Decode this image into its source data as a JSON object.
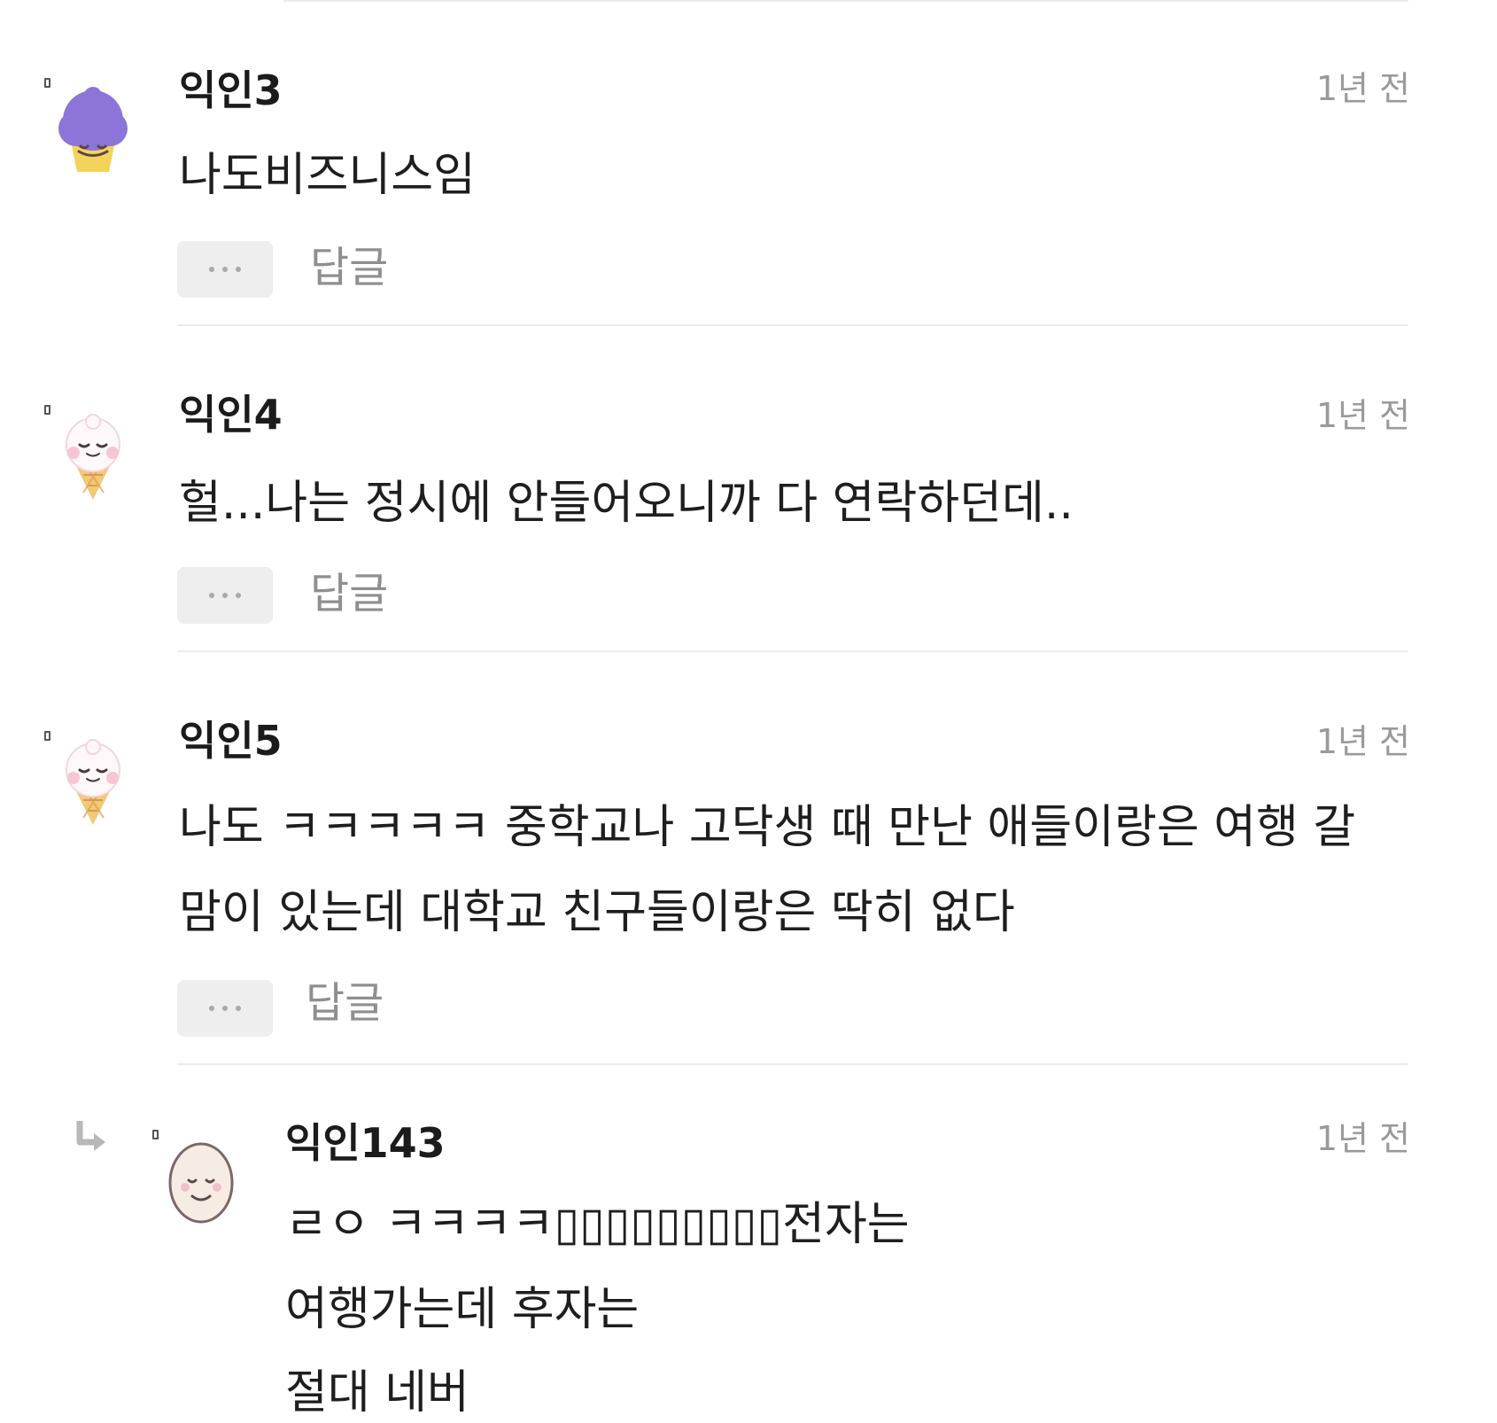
{
  "comments": [
    {
      "author": "익인3",
      "time": "1년 전",
      "lines": [
        "나도비즈니스임"
      ],
      "reply_label": "답글",
      "avatar_icon": "purple-ice-cream-icon"
    },
    {
      "author": "익인4",
      "time": "1년 전",
      "lines": [
        "헐...나는 정시에 안들어오니까 다 연락하던데.."
      ],
      "reply_label": "답글",
      "avatar_icon": "vanilla-ice-cream-cone-icon"
    },
    {
      "author": "익인5",
      "time": "1년 전",
      "lines": [
        "나도 ㅋㅋㅋㅋㅋ 중학교나 고닥생 때 만난 애들이랑은 여행 갈",
        "맘이 있는데 대학교 친구들이랑은 딱히 없다"
      ],
      "reply_label": "답글",
      "avatar_icon": "vanilla-ice-cream-cone-icon"
    }
  ],
  "reply": {
    "author": "익인143",
    "time": "1년 전",
    "lines": [
      "ㄹㅇ ㅋㅋㅋㅋ▯▯▯▯▯▯▯▯▯전자는",
      "여행가는데 후자는",
      "절대 네버"
    ],
    "avatar_icon": "egg-face-icon",
    "reply_arrow_icon": "reply-arrow-icon"
  },
  "colors": {
    "author": "#1b1b1b",
    "time": "#9a9a9a",
    "reply_link": "#8f8f8f",
    "divider": "#ececec",
    "more_button_bg": "#eeeeee",
    "purple_avatar": "#8d74d9"
  }
}
